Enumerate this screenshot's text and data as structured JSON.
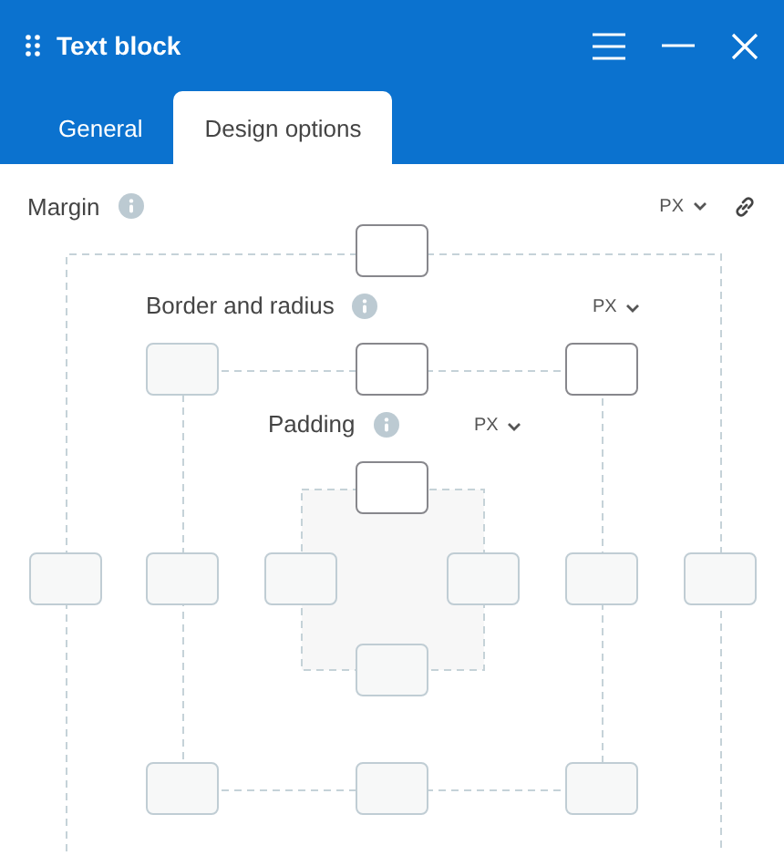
{
  "window": {
    "title": "Text block"
  },
  "tabs": [
    {
      "label": "General",
      "selected": false
    },
    {
      "label": "Design options",
      "selected": true
    }
  ],
  "margin": {
    "label": "Margin",
    "unit": "PX",
    "inputs": [
      {
        "kind": "top",
        "disabled": false
      },
      {
        "kind": "left",
        "disabled": true
      },
      {
        "kind": "right",
        "disabled": true
      }
    ]
  },
  "border": {
    "label": "Border and radius",
    "unit": "PX",
    "inputs": [
      {
        "kind": "topleft",
        "disabled": true
      },
      {
        "kind": "top",
        "disabled": false
      },
      {
        "kind": "topright",
        "disabled": false
      },
      {
        "kind": "left",
        "disabled": true
      },
      {
        "kind": "right",
        "disabled": true
      },
      {
        "kind": "bottomleft",
        "disabled": true
      },
      {
        "kind": "bottom",
        "disabled": true
      },
      {
        "kind": "bottomright",
        "disabled": true
      }
    ]
  },
  "padding": {
    "label": "Padding",
    "unit": "PX",
    "inputs": [
      {
        "kind": "top",
        "disabled": false
      },
      {
        "kind": "left",
        "disabled": true
      },
      {
        "kind": "right",
        "disabled": true
      },
      {
        "kind": "bottom",
        "disabled": true
      }
    ]
  }
}
